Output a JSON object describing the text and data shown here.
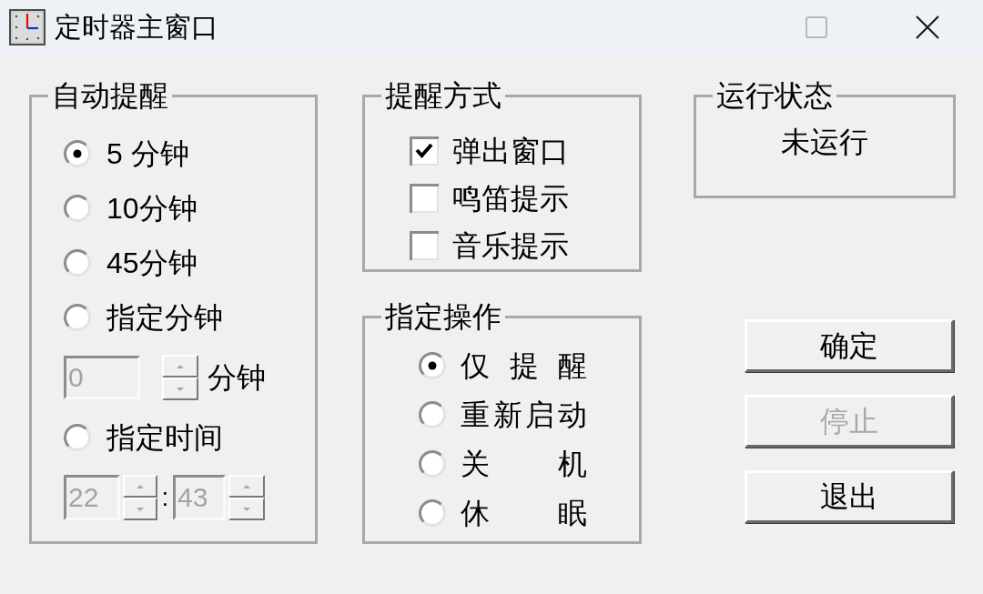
{
  "window": {
    "title": "定时器主窗口",
    "controls": [
      {
        "kind": "maximize",
        "disabled": true
      },
      {
        "kind": "close",
        "disabled": false
      }
    ]
  },
  "auto_reminder": {
    "title": "自动提醒",
    "items": [
      {
        "kind": "radio",
        "label": "5 分钟",
        "selected": true
      },
      {
        "kind": "radio",
        "label": "10分钟",
        "selected": false
      },
      {
        "kind": "radio",
        "label": "45分钟",
        "selected": false
      },
      {
        "kind": "radio",
        "label": "指定分钟",
        "selected": false
      },
      {
        "kind": "minutes",
        "value": "0",
        "unit": "分钟",
        "disabled": true
      },
      {
        "kind": "radio",
        "label": "指定时间",
        "selected": false
      },
      {
        "kind": "time",
        "hour": "22",
        "separator": ":",
        "minute": "43",
        "disabled": true
      }
    ]
  },
  "reminder_method": {
    "title": "提醒方式",
    "options": [
      {
        "label": "弹出窗口",
        "checked": true
      },
      {
        "label": "鸣笛提示",
        "checked": false
      },
      {
        "label": "音乐提示",
        "checked": false
      }
    ]
  },
  "action": {
    "title": "指定操作",
    "options": [
      {
        "label": "仅 提 醒",
        "selected": true
      },
      {
        "label": "重新启动",
        "selected": false
      },
      {
        "label": "关 机",
        "selected": false
      },
      {
        "label": "休 眠",
        "selected": false
      }
    ]
  },
  "run_status": {
    "title": "运行状态",
    "value": "未运行"
  },
  "buttons": [
    {
      "label": "确定",
      "disabled": false
    },
    {
      "label": "停止",
      "disabled": true
    },
    {
      "label": "退出",
      "disabled": false
    }
  ]
}
